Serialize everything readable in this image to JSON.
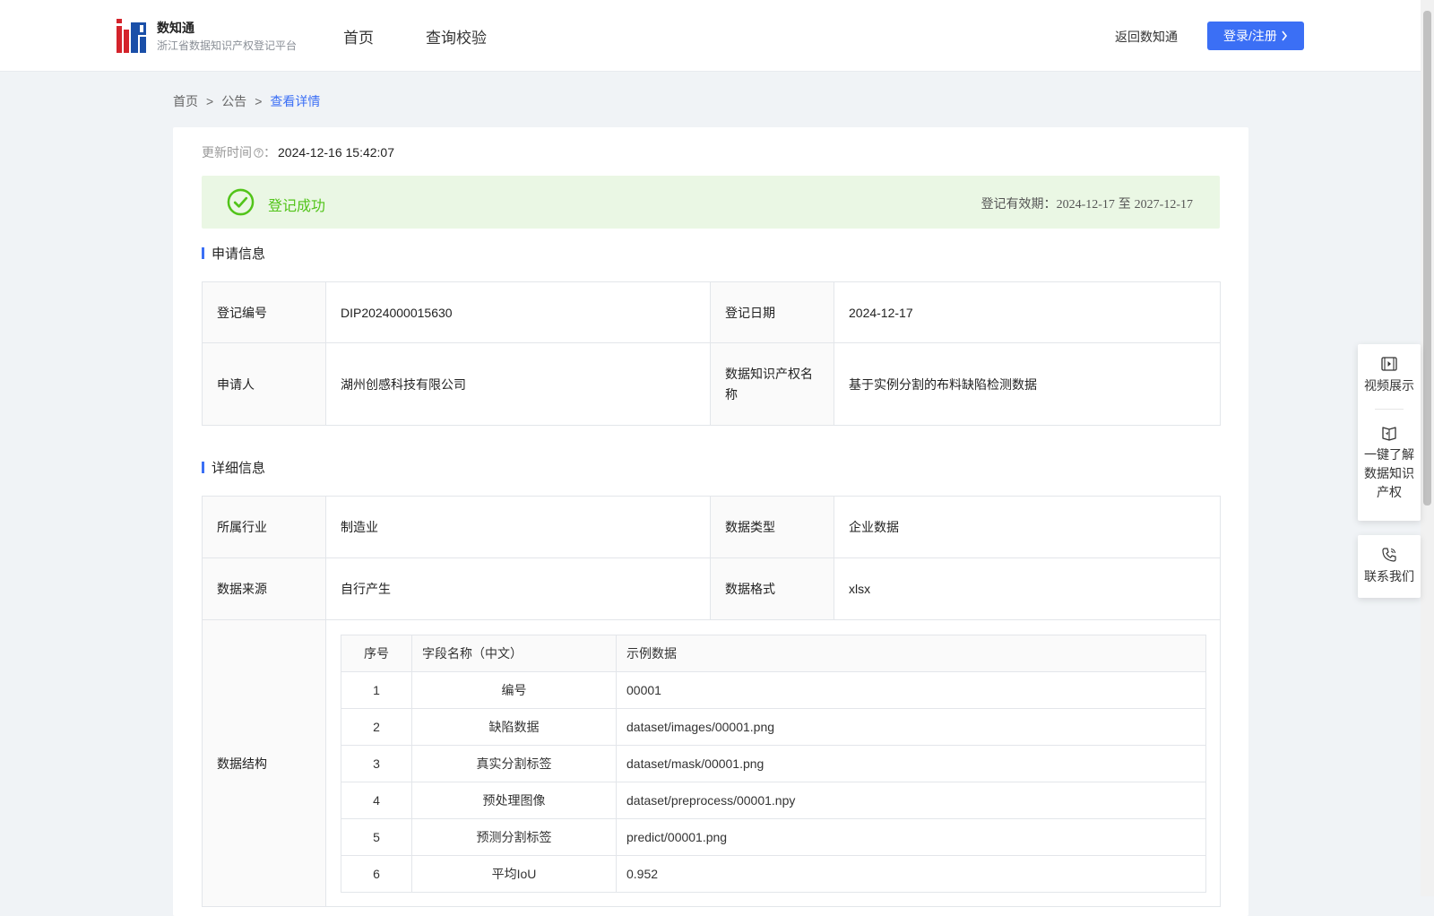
{
  "header": {
    "brand_name": "数知通",
    "brand_sub": "浙江省数据知识产权登记平台",
    "nav": [
      "首页",
      "查询校验"
    ],
    "return_link": "返回数知通",
    "login_label": "登录/注册"
  },
  "breadcrumb": {
    "home": "首页",
    "notice": "公告",
    "current": "查看详情",
    "separator": ">"
  },
  "update": {
    "label": "更新时间",
    "colon": "：",
    "value": "2024-12-16 15:42:07"
  },
  "status": {
    "text": "登记成功",
    "validity_label": "登记有效期：",
    "validity_start": "2024-12-17",
    "validity_to": "至",
    "validity_end": "2027-12-17",
    "color": "#52c41a"
  },
  "application": {
    "title": "申请信息",
    "reg_no_label": "登记编号",
    "reg_no": "DIP2024000015630",
    "reg_date_label": "登记日期",
    "reg_date": "2024-12-17",
    "applicant_label": "申请人",
    "applicant": "湖州创感科技有限公司",
    "ip_name_label": "数据知识产权名称",
    "ip_name": "基于实例分割的布料缺陷检测数据"
  },
  "detail": {
    "title": "详细信息",
    "industry_label": "所属行业",
    "industry": "制造业",
    "data_type_label": "数据类型",
    "data_type": "企业数据",
    "source_label": "数据来源",
    "source": "自行产生",
    "format_label": "数据格式",
    "format": "xlsx",
    "structure_label": "数据结构"
  },
  "structure": {
    "headers": [
      "序号",
      "字段名称（中文）",
      "示例数据"
    ],
    "rows": [
      [
        "1",
        "编号",
        "00001"
      ],
      [
        "2",
        "缺陷数据",
        "dataset/images/00001.png"
      ],
      [
        "3",
        "真实分割标签",
        "dataset/mask/00001.png"
      ],
      [
        "4",
        "预处理图像",
        "dataset/preprocess/00001.npy"
      ],
      [
        "5",
        "预测分割标签",
        "predict/00001.png"
      ],
      [
        "6",
        "平均IoU",
        "0.952"
      ]
    ]
  },
  "side_panel": {
    "video": "视频展示",
    "learn": [
      "一键了解",
      "数据知识",
      "产权"
    ],
    "contact": "联系我们"
  },
  "colors": {
    "accent": "#3b6ff5",
    "success_bg": "#eaf7e4",
    "page_bg": "#f0f3f6"
  }
}
